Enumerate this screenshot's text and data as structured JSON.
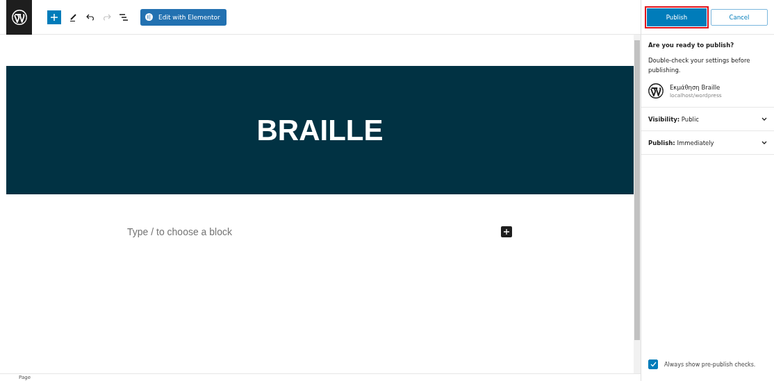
{
  "toolbar": {
    "elementor_button": "Edit with Elementor",
    "redo_disabled": true
  },
  "editor": {
    "banner_title": "BRAILLE",
    "block_placeholder": "Type / to choose a block"
  },
  "footer": {
    "breadcrumb": "Page"
  },
  "publish_panel": {
    "publish_button": {
      "label": "Publish",
      "highlighted": true
    },
    "cancel_button": "Cancel",
    "heading": "Are you ready to publish?",
    "description": "Double-check your settings before publishing.",
    "site": {
      "name": "Εκμάθηση Braille",
      "url": "localhost/wordpress"
    },
    "settings": [
      {
        "label": "Visibility:",
        "value": "Public",
        "expanded": false
      },
      {
        "label": "Publish:",
        "value": "Immediately",
        "expanded": false
      }
    ],
    "always_show_checks": {
      "label": "Always show pre-publish checks.",
      "checked": true
    }
  }
}
